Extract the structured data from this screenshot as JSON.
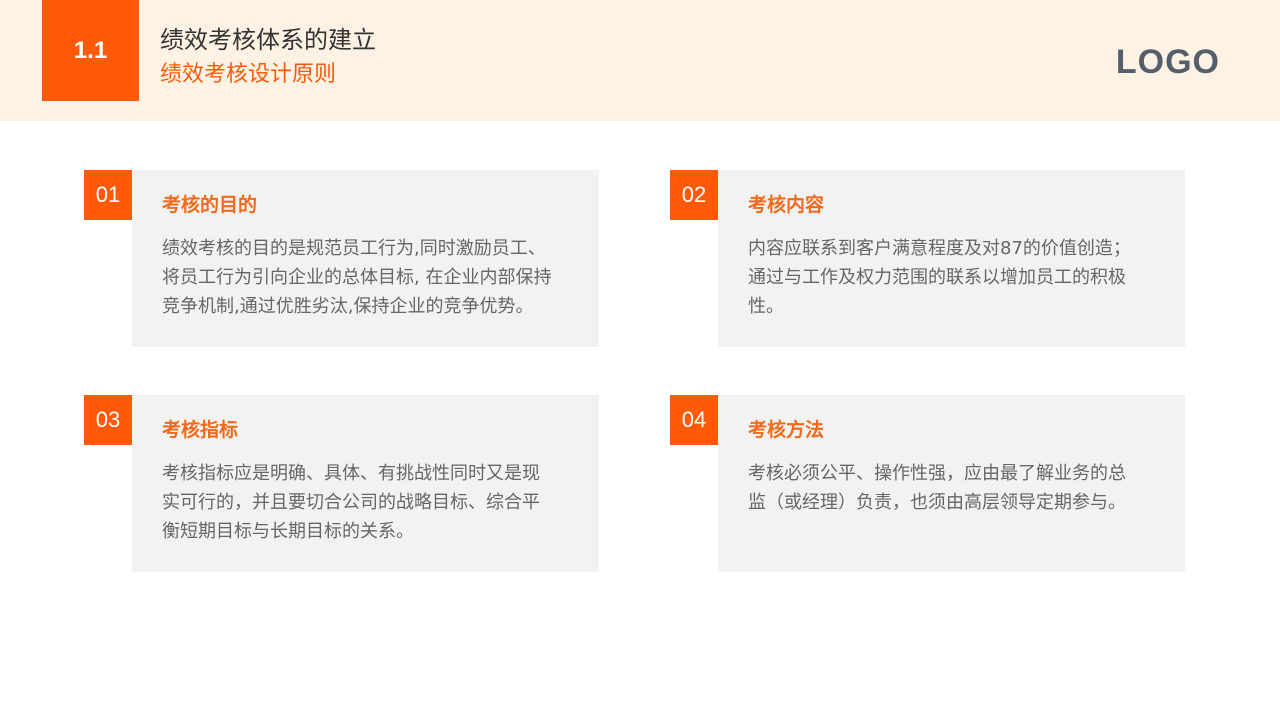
{
  "header": {
    "section_number": "1.1",
    "title": "绩效考核体系的建立",
    "subtitle": "绩效考核设计原则",
    "logo": "LOGO"
  },
  "cards": [
    {
      "number": "01",
      "title": "考核的目的",
      "lines": [
        "绩效考核的目的是规范员工行为,同时激励员工、",
        "将员工行为引向企业的总体目标, 在企业内部保持",
        "竞争机制,通过优胜劣汰,保持企业的竞争优势。"
      ]
    },
    {
      "number": "02",
      "title": "考核内容",
      "lines": [
        "内容应联系到客户满意程度及对87的价值创造；",
        "通过与工作及权力范围的联系以增加员工的积极",
        "性。"
      ]
    },
    {
      "number": "03",
      "title": "考核指标",
      "lines": [
        "考核指标应是明确、具体、有挑战性同时又是现",
        "实可行的，并且要切合公司的战略目标、综合平",
        "衡短期目标与长期目标的关系。"
      ]
    },
    {
      "number": "04",
      "title": "考核方法",
      "lines": [
        "考核必须公平、操作性强，应由最了解业务的总",
        "监（或经理）负责，也须由高层领导定期参与。"
      ]
    }
  ],
  "colors": {
    "accent": "#ff5a0a",
    "header_bg": "#fdf2e3",
    "card_bg": "#f2f2f2",
    "title_text": "#333333",
    "body_text": "#666666",
    "logo_text": "#555e6b"
  }
}
